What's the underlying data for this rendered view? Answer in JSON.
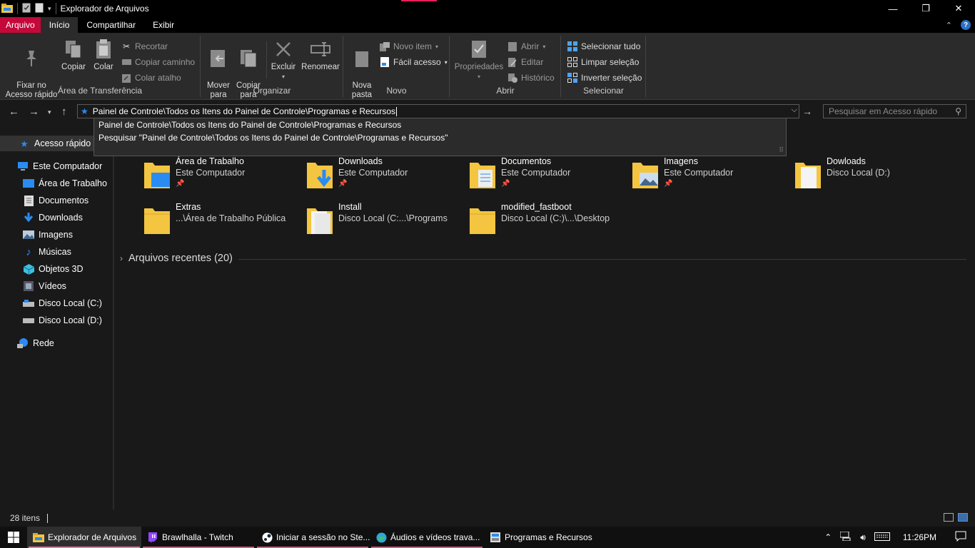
{
  "window": {
    "title": "Explorador de Arquivos"
  },
  "ribbon_tabs": [
    {
      "label": "Arquivo"
    },
    {
      "label": "Início"
    },
    {
      "label": "Compartilhar"
    },
    {
      "label": "Exibir"
    }
  ],
  "ribbon": {
    "clipboard": {
      "label": "Área de Transferência",
      "pin": "Fixar no\nAcesso rápido",
      "copy": "Copiar",
      "paste": "Colar",
      "cut": "Recortar",
      "copy_path": "Copiar caminho",
      "paste_shortcut": "Colar atalho"
    },
    "organize": {
      "label": "Organizar",
      "move": "Mover\npara",
      "copy_to": "Copiar\npara",
      "delete": "Excluir",
      "rename": "Renomear"
    },
    "new": {
      "label": "Novo",
      "new_folder": "Nova\npasta",
      "new_item": "Novo item",
      "easy_access": "Fácil acesso"
    },
    "open": {
      "label": "Abrir",
      "properties": "Propriedades",
      "open": "Abrir",
      "edit": "Editar",
      "history": "Histórico"
    },
    "select": {
      "label": "Selecionar",
      "select_all": "Selecionar tudo",
      "select_none": "Limpar seleção",
      "invert": "Inverter seleção"
    }
  },
  "address": {
    "value": "Painel de Controle\\Todos os Itens do Painel de Controle\\Programas e Recursos",
    "search_placeholder": "Pesquisar em Acesso rápido"
  },
  "autocomplete": [
    "Painel de Controle\\Todos os Itens do Painel de Controle\\Programas e Recursos",
    "Pesquisar \"Painel de Controle\\Todos os Itens do Painel de Controle\\Programas e Recursos\""
  ],
  "sidebar": {
    "quick_access": "Acesso rápido",
    "this_pc": "Este Computador",
    "items": [
      {
        "label": "Área de Trabalho",
        "icon": "desktop-icon"
      },
      {
        "label": "Documentos",
        "icon": "documents-icon"
      },
      {
        "label": "Downloads",
        "icon": "downloads-icon"
      },
      {
        "label": "Imagens",
        "icon": "pictures-icon"
      },
      {
        "label": "Músicas",
        "icon": "music-icon"
      },
      {
        "label": "Objetos 3D",
        "icon": "3d-objects-icon"
      },
      {
        "label": "Vídeos",
        "icon": "videos-icon"
      },
      {
        "label": "Disco Local (C:)",
        "icon": "drive-icon"
      },
      {
        "label": "Disco Local (D:)",
        "icon": "drive-icon"
      }
    ],
    "network": "Rede"
  },
  "folders": [
    {
      "name": "Área de Trabalho",
      "location": "Este Computador",
      "pinned": true
    },
    {
      "name": "Downloads",
      "location": "Este Computador",
      "pinned": true
    },
    {
      "name": "Documentos",
      "location": "Este Computador",
      "pinned": true
    },
    {
      "name": "Imagens",
      "location": "Este Computador",
      "pinned": true
    },
    {
      "name": "Dowloads",
      "location": "Disco Local (D:)",
      "pinned": false
    },
    {
      "name": "Extras",
      "location": "...\\Área de Trabalho Pública",
      "pinned": false
    },
    {
      "name": "Install",
      "location": "Disco Local (C:...\\Programs",
      "pinned": false
    },
    {
      "name": "modified_fastboot",
      "location": "Disco Local (C:)\\...\\Desktop",
      "pinned": false
    }
  ],
  "recent": {
    "label": "Arquivos recentes (20)"
  },
  "status": {
    "count": "28 itens"
  },
  "taskbar": {
    "items": [
      {
        "label": "Explorador de Arquivos",
        "icon": "folder-icon",
        "active": true
      },
      {
        "label": "Brawlhalla - Twitch",
        "icon": "twitch-icon",
        "active": false
      },
      {
        "label": "Iniciar a sessão no Ste...",
        "icon": "steam-icon",
        "active": false
      },
      {
        "label": "Áudios e vídeos trava...",
        "icon": "edge-icon",
        "active": false
      },
      {
        "label": "Programas e Recursos",
        "icon": "control-panel-icon",
        "active": false
      }
    ],
    "clock": "11:26PM"
  },
  "colors": {
    "accent_file_tab": "#c4083a",
    "folder_yellow": "#f3c540",
    "link_blue": "#2a8bf2"
  }
}
